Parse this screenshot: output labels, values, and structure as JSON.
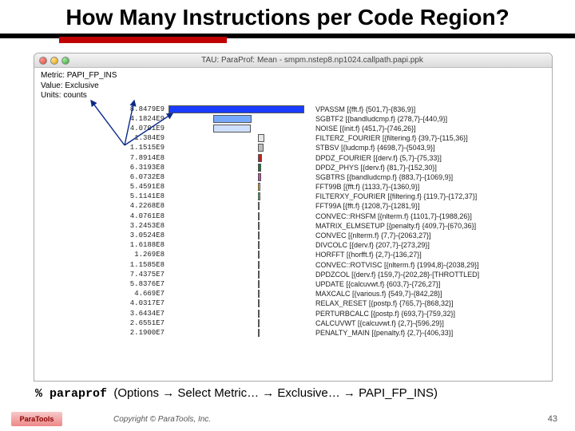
{
  "slide": {
    "title": "How Many Instructions per Code Region?",
    "command_line": "% paraprof  (Options → Select Metric… → Exclusive… → PAPI_FP_INS)",
    "copyright": "Copyright © ParaTools, Inc.",
    "page": "43",
    "logo": "ParaTools"
  },
  "window": {
    "caption": "TAU: ParaProf: Mean - smpm.nstep8.np1024.callpath.papi.ppk",
    "metric": "Metric: PAPI_FP_INS",
    "value": "Value: Exclusive",
    "units": "Units: counts"
  },
  "chart_data": {
    "type": "bar",
    "title": "PAPI_FP_INS Exclusive counts",
    "xlabel": "",
    "ylabel": "",
    "series": [
      {
        "value": 8847900000.0,
        "label": "8.8479E9",
        "name": "VPASSM [{fft.f} {501,7}-{836,9}]",
        "color": "#1a3cff",
        "indent": 0
      },
      {
        "value": 4182400000.0,
        "label": "4.1824E9",
        "name": "SGBTF2 [{bandludcmp.f} {278,7}-{440,9}]",
        "color": "#77aaff",
        "indent": 1
      },
      {
        "value": 4070100000.0,
        "label": "4.0701E9",
        "name": "NOISE [{init.f} {451,7}-{746,26}]",
        "color": "#cfe0ff",
        "indent": 1
      },
      {
        "value": 1384000000.0,
        "label": "1.384E9",
        "name": "FILTERZ_FOURIER [{filtering.f} {39,7}-{115,36}]",
        "color": "#e6e6e6",
        "indent": 2
      },
      {
        "value": 1151500000.0,
        "label": "1.1515E9",
        "name": "STBSV [{ludcmp.f} {4698,7}-{5043,9}]",
        "color": "#bcbcbc",
        "indent": 2
      },
      {
        "value": 789140000.0,
        "label": "7.8914E8",
        "name": "DPDZ_FOURIER [{derv.f} {5,7}-{75,33}]",
        "color": "#c02020",
        "indent": 2
      },
      {
        "value": 631930000.0,
        "label": "6.3193E8",
        "name": "DPDZ_PHYS [{derv.f} {81,7}-{152,30}]",
        "color": "#007d32",
        "indent": 2
      },
      {
        "value": 607320000.0,
        "label": "6.0732E8",
        "name": "SGBTRS [{bandludcmp.f} {883,7}-{1069,9}]",
        "color": "#d43fbf",
        "indent": 2
      },
      {
        "value": 545910000.0,
        "label": "5.4591E8",
        "name": "FFT99B [{fft.f} {1133,7}-{1360,9}]",
        "color": "#ffb000",
        "indent": 2
      },
      {
        "value": 511410000.0,
        "label": "5.1141E8",
        "name": "FILTERXY_FOURIER [{filtering.f} {119,7}-{172,37}]",
        "color": "#40c060",
        "indent": 2
      },
      {
        "value": 422680000.0,
        "label": "4.2268E8",
        "name": "FFT99A [{fft.f} {1208,7}-{1281,9}]",
        "color": "#1f5fd0",
        "indent": 2
      },
      {
        "value": 407610000.0,
        "label": "4.0761E8",
        "name": "CONVEC::RHSFM [{nlterm.f} {1101,7}-{1988,26}]",
        "color": "#a02020",
        "indent": 2
      },
      {
        "value": 324530000.0,
        "label": "3.2453E8",
        "name": "MATRIX_ELMSETUP [{penalty.f} {409,7}-{670,36}]",
        "color": "#e8d050",
        "indent": 2
      },
      {
        "value": 305240000.0,
        "label": "3.0524E8",
        "name": "CONVEC [{nlterm.f} {7,7}-{2063,27}]",
        "color": "#7fb77f",
        "indent": 2
      },
      {
        "value": 161880000.0,
        "label": "1.6188E8",
        "name": "DIVCOLC [{derv.f} {207,7}-{273,29}]",
        "color": "#d080d0",
        "indent": 2
      },
      {
        "value": 126900000.0,
        "label": "1.269E8",
        "name": "HORFFT [{horfft.f} {2,7}-{136,27}]",
        "color": "#606060",
        "indent": 2
      },
      {
        "value": 115850000.0,
        "label": "1.1585E8",
        "name": "CONVEC::ROTVISC [{nlterm.f} {1994,8}-{2038,29}]",
        "color": "#f08040",
        "indent": 2
      },
      {
        "value": 74375000.0,
        "label": "7.4375E7",
        "name": "DPDZCOL [{derv.f} {159,7}-{202,28}-[THROTTLED]",
        "color": "#6b8e23",
        "indent": 2
      },
      {
        "value": 58376000.0,
        "label": "5.8376E7",
        "name": "UPDATE [{calcuvwt.f} {603,7}-{726,27}]",
        "color": "#2e8b57",
        "indent": 2
      },
      {
        "value": 46690000.0,
        "label": "4.669E7",
        "name": "MAXCALC [{various.f} {549,7}-{842,28}]",
        "color": "#2a2a2a",
        "indent": 2
      },
      {
        "value": 40317000.0,
        "label": "4.0317E7",
        "name": "RELAX_RESET [{postp.f} {765,7}-{868,32}]",
        "color": "#a080ff",
        "indent": 2
      },
      {
        "value": 36434000.0,
        "label": "3.6434E7",
        "name": "PERTURBCALC [{postp.f} {693,7}-{759,32}]",
        "color": "#9acd32",
        "indent": 2
      },
      {
        "value": 26551000.0,
        "label": "2.6551E7",
        "name": "CALCUVWT [{calcuvwt.f} {2,7}-{596,29}]",
        "color": "#c0c0c0",
        "indent": 2
      },
      {
        "value": 21900000.0,
        "label": "2.1900E7",
        "name": "PENALTY_MAIN [{penalty.f} {2,7}-{406,33}]",
        "color": "#a0522d",
        "indent": 2
      }
    ]
  }
}
